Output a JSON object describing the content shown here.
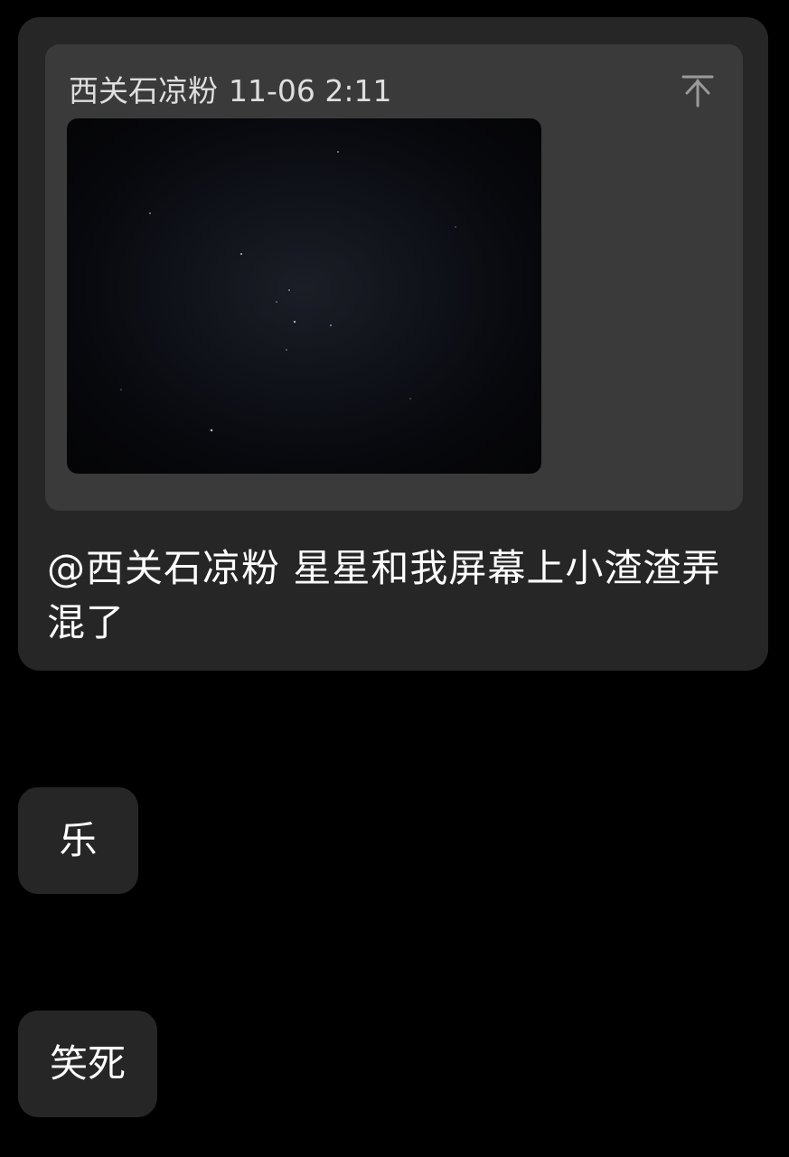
{
  "messages": {
    "main": {
      "quote": {
        "sender": "西关石凉粉",
        "timestamp": "11-06 2:11",
        "image_label": "night-sky-photo",
        "jump_icon": "arrow-to-top-icon"
      },
      "text": "@西关石凉粉 星星和我屏幕上小渣渣弄混了"
    },
    "reply_1": {
      "text": "乐"
    },
    "reply_2": {
      "text": "笑死"
    }
  },
  "colors": {
    "background": "#000000",
    "bubble": "#262626",
    "quote_card": "#3a3a3a",
    "meta_text": "#dedede",
    "text": "#ffffff"
  }
}
